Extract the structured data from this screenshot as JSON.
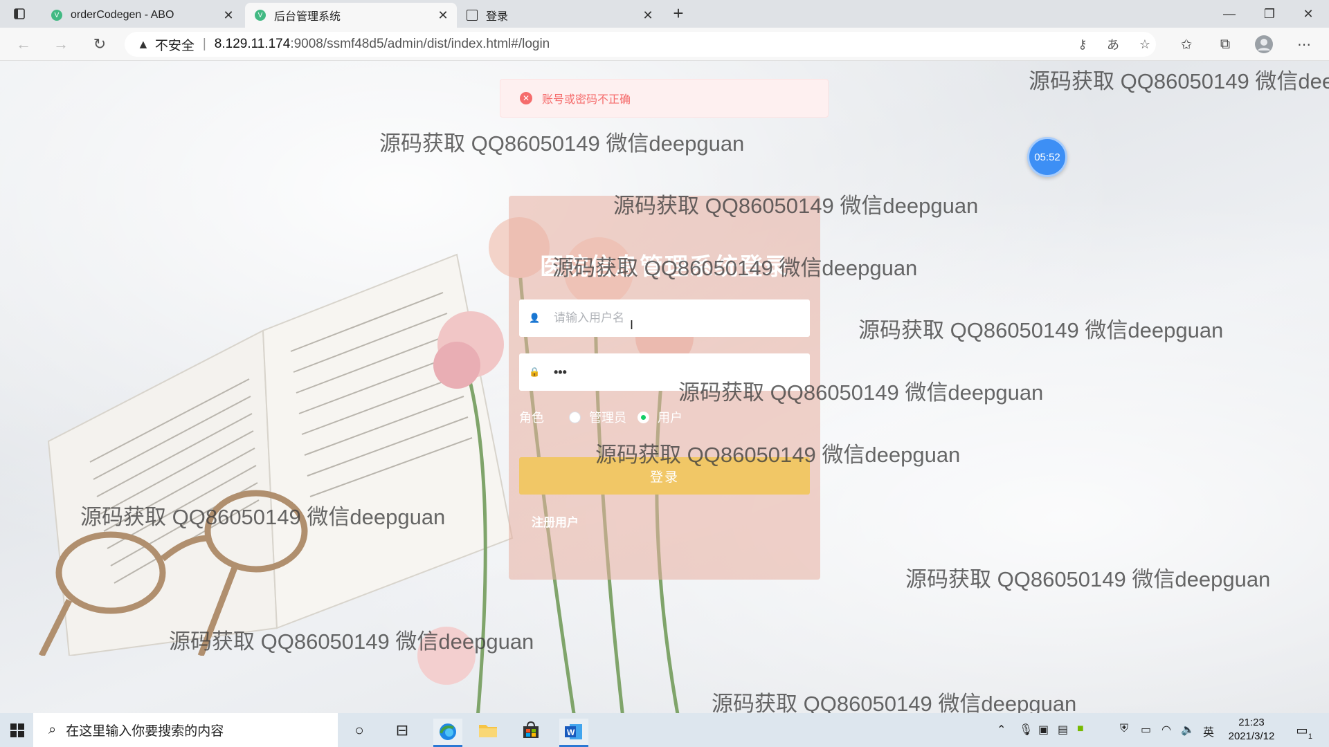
{
  "browser": {
    "tabs": [
      {
        "title": "orderCodegen - ABO",
        "active": false
      },
      {
        "title": "后台管理系统",
        "active": true
      },
      {
        "title": "登录",
        "active": false
      }
    ],
    "security_label": "不安全",
    "url_host": "8.129.11.174",
    "url_path": ":9008/ssmf48d5/admin/dist/index.html#/login"
  },
  "page": {
    "error_message": "账号或密码不正确",
    "timer": "05:52",
    "title": "医院信息管理系统登录",
    "username_placeholder": "请输入用户名",
    "password_value": "•••",
    "role_label": "角色",
    "roles": [
      {
        "label": "管理员",
        "selected": false
      },
      {
        "label": "用户",
        "selected": true
      }
    ],
    "login_button": "登录",
    "register_link": "注册用户"
  },
  "watermark_text": "源码获取 QQ86050149 微信deepguan",
  "taskbar": {
    "search_placeholder": "在这里输入你要搜索的内容",
    "ime": "英",
    "time": "21:23",
    "date": "2021/3/12",
    "notification_count": "1"
  }
}
